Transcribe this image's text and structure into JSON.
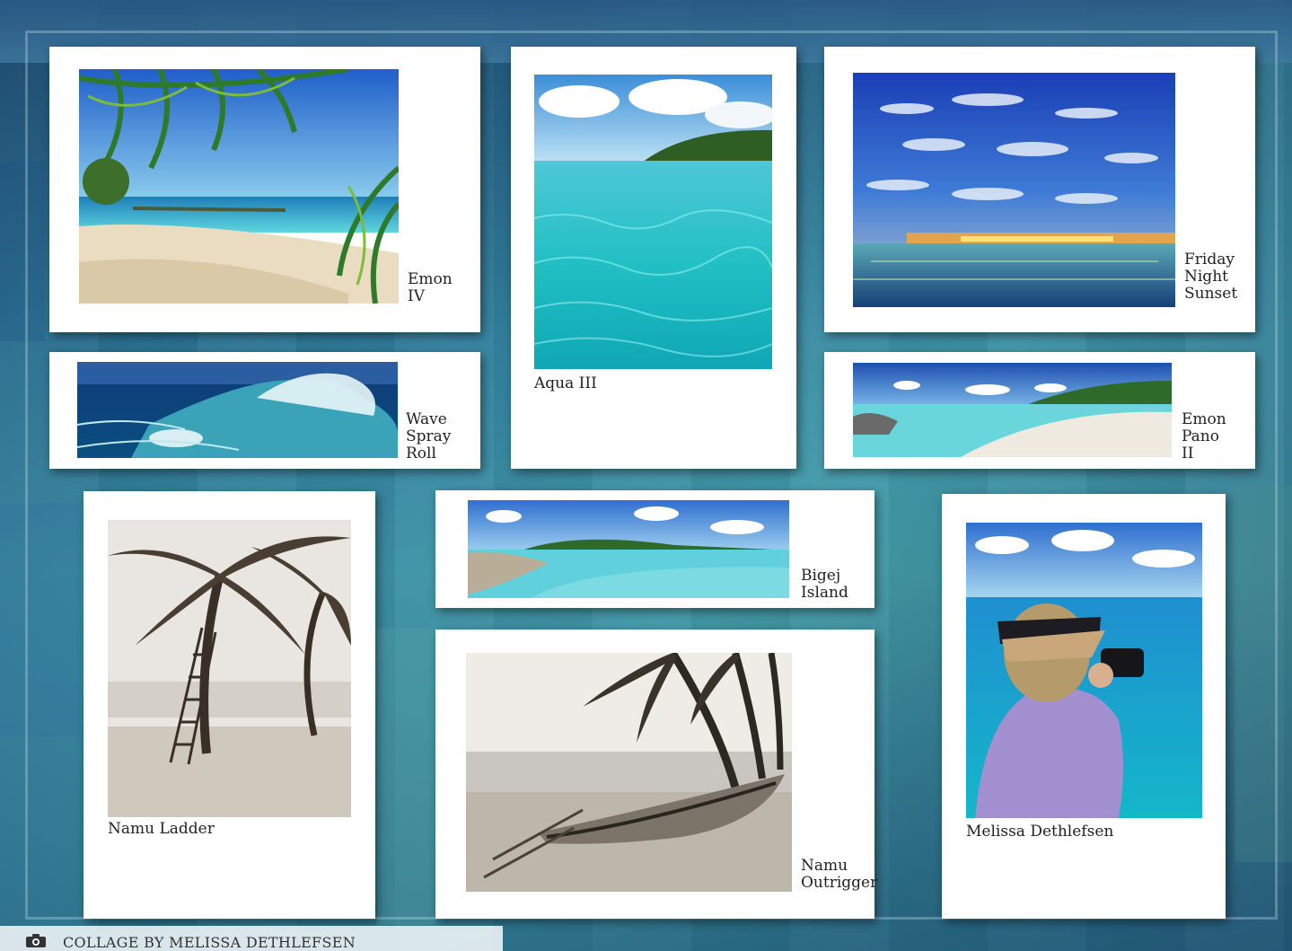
{
  "credit": {
    "text": "COLLAGE BY MELISSA DETHLEFSEN",
    "icon": "camera-icon"
  },
  "photos": [
    {
      "id": "emon-iv",
      "caption": "Emon\nIV",
      "tone": "color",
      "subject": "palm-fronds-beach"
    },
    {
      "id": "aqua-iii",
      "caption": "Aqua III",
      "tone": "color",
      "subject": "turquoise-water-island"
    },
    {
      "id": "friday-night-sunset",
      "caption": "Friday\nNight\nSunset",
      "tone": "color",
      "subject": "cloud-sunset-sea"
    },
    {
      "id": "wave-spray-roll",
      "caption": "Wave\nSpray\nRoll",
      "tone": "color",
      "subject": "breaking-wave"
    },
    {
      "id": "emon-pano-ii",
      "caption": "Emon\nPano\nII",
      "tone": "color",
      "subject": "panoramic-lagoon"
    },
    {
      "id": "namu-ladder",
      "caption": "Namu Ladder",
      "tone": "sepia",
      "subject": "palm-with-ladder"
    },
    {
      "id": "bigej-island",
      "caption": "Bigej\nIsland",
      "tone": "color",
      "subject": "island-panorama"
    },
    {
      "id": "namu-outrigger",
      "caption": "Namu\nOutrigger",
      "tone": "sepia",
      "subject": "outrigger-canoe-palms"
    },
    {
      "id": "melissa-dethlefsen",
      "caption": "Melissa Dethlefsen",
      "tone": "color",
      "subject": "photographer-with-camera"
    }
  ],
  "colors": {
    "background": "#2f6b8a",
    "card": "#ffffff",
    "caption": "#222222"
  }
}
